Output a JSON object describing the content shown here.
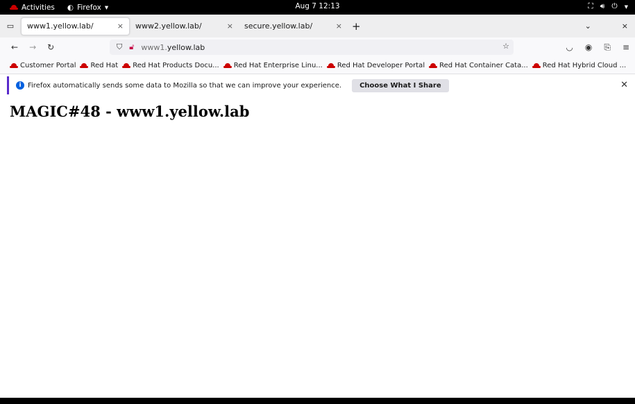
{
  "topbar": {
    "activities": "Activities",
    "app": "Firefox",
    "clock": "Aug 7  12:13"
  },
  "tabs": [
    {
      "label": "www1.yellow.lab/",
      "active": true
    },
    {
      "label": "www2.yellow.lab/",
      "active": false
    },
    {
      "label": "secure.yellow.lab/",
      "active": false
    }
  ],
  "urlbar": {
    "prefix": "www1.",
    "host": "yellow.lab"
  },
  "bookmarks": [
    "Customer Portal",
    "Red Hat",
    "Red Hat Products Docu...",
    "Red Hat Enterprise Linu...",
    "Red Hat Developer Portal",
    "Red Hat Container Cata...",
    "Red Hat Hybrid Cloud ..."
  ],
  "notice": {
    "message": "Firefox automatically sends some data to Mozilla so that we can improve your experience.",
    "button": "Choose What I Share"
  },
  "page": {
    "heading": "MAGIC#48 - www1.yellow.lab"
  },
  "colors": {
    "accent": "#592acb",
    "brand_red": "#cc0000",
    "info_blue": "#0060df"
  }
}
